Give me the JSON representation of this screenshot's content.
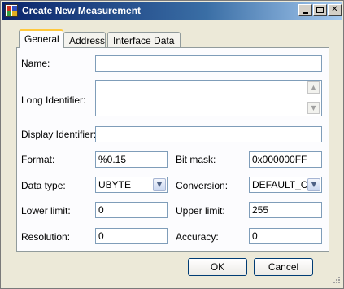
{
  "window": {
    "title": "Create New Measurement",
    "close_glyph": "✕"
  },
  "tabs": [
    {
      "label": "General",
      "active": true
    },
    {
      "label": "Address",
      "active": false
    },
    {
      "label": "Interface Data",
      "active": false
    }
  ],
  "form": {
    "name": {
      "label": "Name:",
      "value": ""
    },
    "long_identifier": {
      "label": "Long Identifier:",
      "value": ""
    },
    "display_identifier": {
      "label": "Display Identifier:",
      "value": ""
    },
    "format": {
      "label": "Format:",
      "value": "%0.15"
    },
    "bit_mask": {
      "label": "Bit mask:",
      "value": "0x000000FF"
    },
    "data_type": {
      "label": "Data type:",
      "value": "UBYTE"
    },
    "conversion": {
      "label": "Conversion:",
      "value": "DEFAULT_CM"
    },
    "lower_limit": {
      "label": "Lower limit:",
      "value": "0"
    },
    "upper_limit": {
      "label": "Upper limit:",
      "value": "255"
    },
    "resolution": {
      "label": "Resolution:",
      "value": "0"
    },
    "accuracy": {
      "label": "Accuracy:",
      "value": "0"
    }
  },
  "glyphs": {
    "scroll_up": "▲",
    "scroll_down": "▼",
    "combo_down": "▼"
  },
  "buttons": {
    "ok": "OK",
    "cancel": "Cancel"
  }
}
